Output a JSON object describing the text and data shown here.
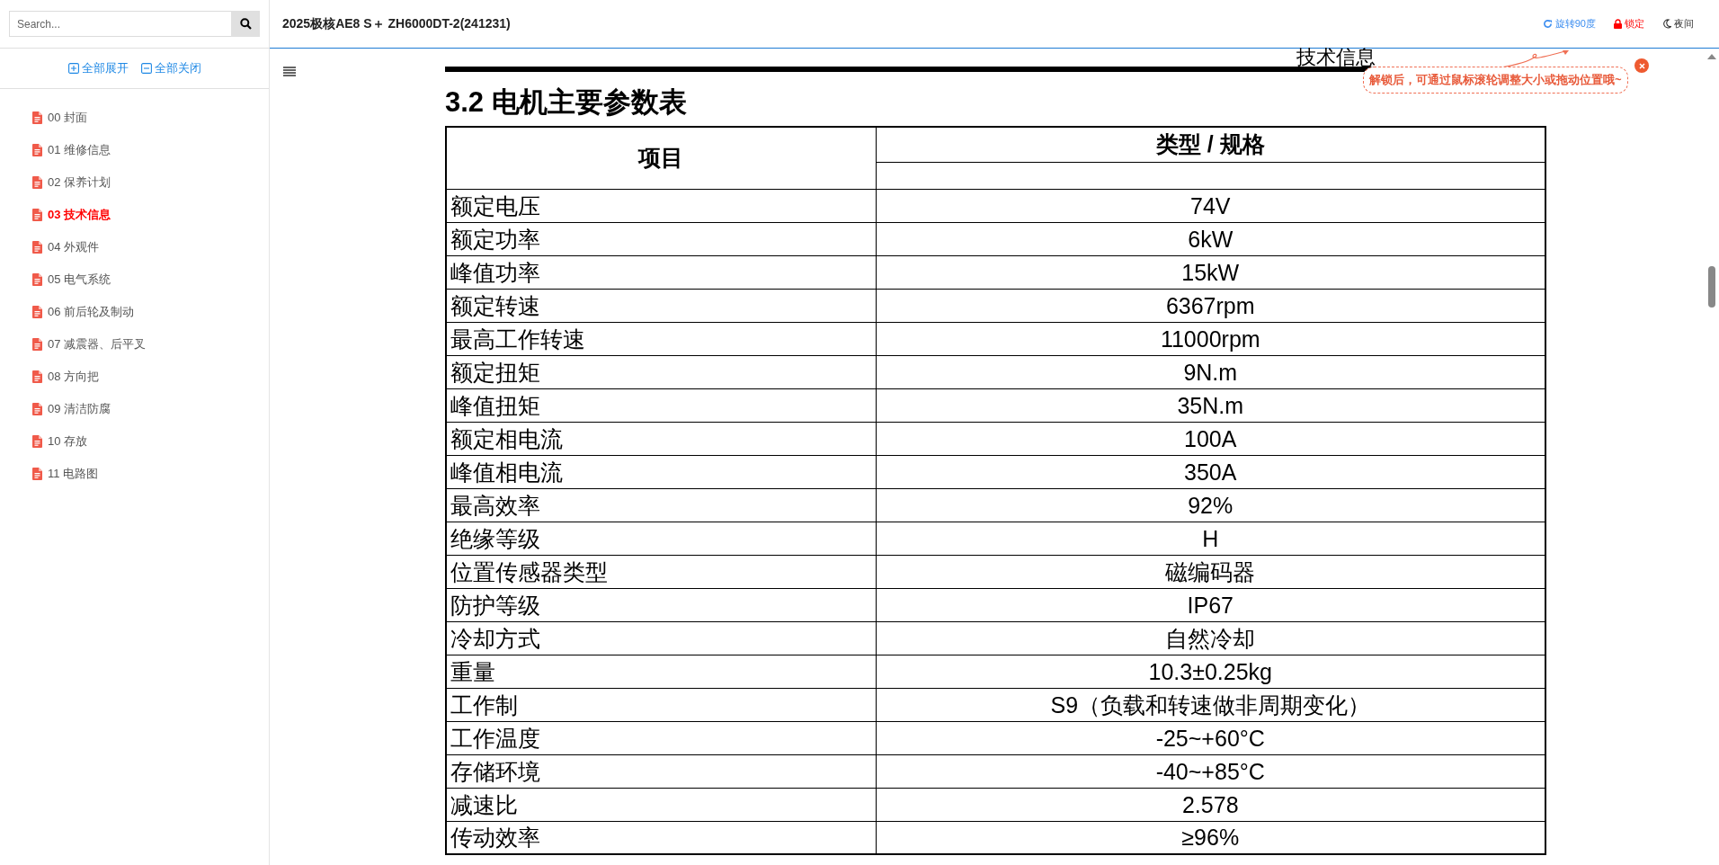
{
  "sidebar": {
    "search": {
      "placeholder": "Search..."
    },
    "actions": [
      {
        "kind": "expand",
        "label": "全部展开"
      },
      {
        "kind": "collapse",
        "label": "全部关闭"
      }
    ],
    "items": [
      {
        "label": "00 封面",
        "selected": false
      },
      {
        "label": "01 维修信息",
        "selected": false
      },
      {
        "label": "02 保养计划",
        "selected": false
      },
      {
        "label": "03 技术信息",
        "selected": true
      },
      {
        "label": "04 外观件",
        "selected": false
      },
      {
        "label": "05 电气系统",
        "selected": false
      },
      {
        "label": "06 前后轮及制动",
        "selected": false
      },
      {
        "label": "07 减震器、后平叉",
        "selected": false
      },
      {
        "label": "08 方向把",
        "selected": false
      },
      {
        "label": "09 清洁防腐",
        "selected": false
      },
      {
        "label": "10 存放",
        "selected": false
      },
      {
        "label": "11 电路图",
        "selected": false
      }
    ]
  },
  "header": {
    "title": "2025极核AE8 S＋ ZH6000DT-2(241231)",
    "buttons": [
      {
        "kind": "rotate",
        "label": "旋转90度"
      },
      {
        "kind": "lock",
        "label": "锁定"
      },
      {
        "kind": "night",
        "label": "夜间"
      }
    ]
  },
  "tooltip": {
    "text": "解锁后，可通过鼠标滚轮调整大小或拖动位置哦~"
  },
  "document": {
    "page_heading": "技术信息",
    "section_title": "3.2 电机主要参数表",
    "table": {
      "columns": [
        "项目",
        "类型 / 规格"
      ],
      "rows": [
        [
          "额定电压",
          "74V"
        ],
        [
          "额定功率",
          "6kW"
        ],
        [
          "峰值功率",
          "15kW"
        ],
        [
          "额定转速",
          "6367rpm"
        ],
        [
          "最高工作转速",
          "11000rpm"
        ],
        [
          "额定扭矩",
          "9N.m"
        ],
        [
          "峰值扭矩",
          "35N.m"
        ],
        [
          "额定相电流",
          "100A"
        ],
        [
          "峰值相电流",
          "350A"
        ],
        [
          "最高效率",
          "92%"
        ],
        [
          "绝缘等级",
          "H"
        ],
        [
          "位置传感器类型",
          "磁编码器"
        ],
        [
          "防护等级",
          "IP67"
        ],
        [
          "冷却方式",
          "自然冷却"
        ],
        [
          "重量",
          "10.3±0.25kg"
        ],
        [
          "工作制",
          "S9（负载和转速做非周期变化）"
        ],
        [
          "工作温度",
          "-25~+60°C"
        ],
        [
          "存储环境",
          "-40~+85°C"
        ],
        [
          "减速比",
          "2.578"
        ],
        [
          "传动效率",
          "≥96%"
        ]
      ]
    }
  }
}
